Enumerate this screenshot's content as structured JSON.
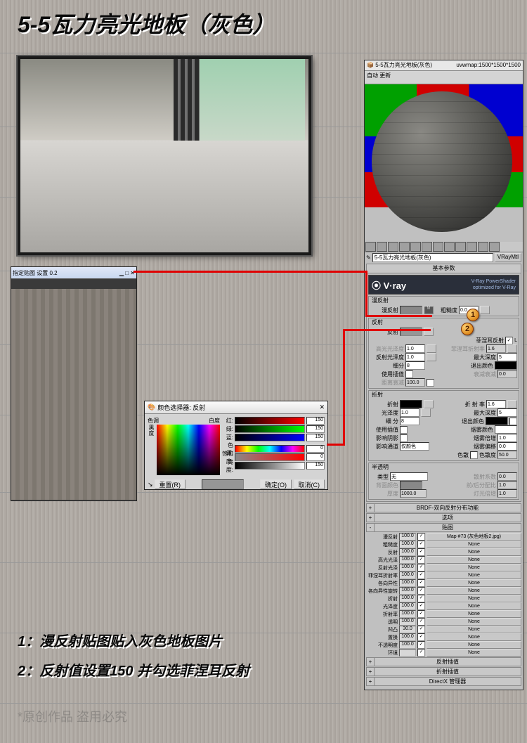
{
  "title": "5-5瓦力亮光地板（灰色）",
  "instruction1": "1：漫反射贴图贴入灰色地板图片",
  "instruction2": "2：反射值设置150 并勾选菲涅耳反射",
  "watermark": "*原创作品 盗用必究",
  "mat_editor": {
    "window_title": "5-5瓦力亮光地板(灰色)",
    "uvw": "uvwmap:1500*1500*1500",
    "toolbar": "自动  更新",
    "material_name": "5-5瓦力亮光地板(灰色)",
    "material_type": "VRayMtl",
    "section_basic": "基本参数",
    "vray_brand": "V·ray",
    "vray_sub": "V-Ray PowerShader",
    "vray_sub2": "optimized for V-Ray",
    "diffuse_grp": "漫反射",
    "diffuse_lbl": "漫反射",
    "roughness_lbl": "粗糙度",
    "roughness_val": "0.0",
    "reflect_grp": "反射",
    "reflect_lbl": "反射",
    "fresnel_lbl": "菲涅耳反射",
    "hilight_lbl": "高光光泽度",
    "hilight_val": "1.0",
    "fresnel_ior_lbl": "菲涅耳折射率",
    "fresnel_ior_val": "1.6",
    "refl_glossy_lbl": "反射光泽度",
    "refl_glossy_val": "1.0",
    "max_depth_lbl": "最大深度",
    "max_depth_val": "5",
    "subdiv_lbl": "细分",
    "subdiv_val": "8",
    "exit_color_lbl": "退出颜色",
    "use_interp_lbl": "使用插值",
    "dim_dist_lbl": "距离衰减",
    "dim_dist_val": "100.0",
    "dim_falloff_lbl": "衰减衰减",
    "dim_falloff_val": "0.0",
    "refract_grp": "折射",
    "refract_lbl": "折射",
    "ior_lbl": "折 射 率",
    "ior_val": "1.6",
    "glossy_lbl": "光泽度",
    "glossy_val": "1.0",
    "refr_depth_lbl": "最大深度",
    "refr_depth_val": "5",
    "refr_sub_lbl": "细 分",
    "refr_sub_val": "8",
    "refr_exit_lbl": "退出颜色",
    "refr_interp_lbl": "使用插值",
    "fog_color_lbl": "烟雾颜色",
    "affect_sh_lbl": "影响阴影",
    "fog_mult_lbl": "烟雾倍增",
    "fog_mult_val": "1.0",
    "affect_ch_lbl": "影响通道",
    "affect_ch_val": "仅颜色",
    "fog_bias_lbl": "烟雾偏移",
    "fog_bias_val": "0.0",
    "dispersion_lbl": "色散",
    "disp_abbe_lbl": "色散度",
    "disp_abbe_val": "50.0",
    "translucent_grp": "半透明",
    "trans_type_lbl": "类型",
    "trans_type_val": "无",
    "scatter_lbl": "散射系数",
    "scatter_val": "0.0",
    "back_color_lbl": "背面颜色",
    "fwd_back_lbl": "前/后分配比",
    "fwd_back_val": "1.0",
    "thickness_lbl": "厚度",
    "thickness_val": "1000.0",
    "light_mult_lbl": "灯光倍增",
    "light_mult_val": "1.0",
    "brdf_rollout": "BRDF-双向反射分布功能",
    "options_rollout": "选项",
    "maps_rollout": "贴图",
    "maps": [
      {
        "lbl": "漫反射",
        "val": "100.0",
        "chk": "✓",
        "slot": "Map #73 (灰色地板2.jpg)"
      },
      {
        "lbl": "粗糙度",
        "val": "100.0",
        "chk": "✓",
        "slot": "None"
      },
      {
        "lbl": "反射",
        "val": "100.0",
        "chk": "✓",
        "slot": "None"
      },
      {
        "lbl": "高光光泽",
        "val": "100.0",
        "chk": "✓",
        "slot": "None"
      },
      {
        "lbl": "反射光泽",
        "val": "100.0",
        "chk": "✓",
        "slot": "None"
      },
      {
        "lbl": "菲涅耳折射率",
        "val": "100.0",
        "chk": "✓",
        "slot": "None"
      },
      {
        "lbl": "各向异性",
        "val": "100.0",
        "chk": "✓",
        "slot": "None"
      },
      {
        "lbl": "各向异性旋转",
        "val": "100.0",
        "chk": "✓",
        "slot": "None"
      },
      {
        "lbl": "折射",
        "val": "100.0",
        "chk": "✓",
        "slot": "None"
      },
      {
        "lbl": "光泽度",
        "val": "100.0",
        "chk": "✓",
        "slot": "None"
      },
      {
        "lbl": "折射率",
        "val": "100.0",
        "chk": "✓",
        "slot": "None"
      },
      {
        "lbl": "透明",
        "val": "100.0",
        "chk": "✓",
        "slot": "None"
      },
      {
        "lbl": "凹凸",
        "val": "30.0",
        "chk": "✓",
        "slot": "None"
      },
      {
        "lbl": "置换",
        "val": "100.0",
        "chk": "✓",
        "slot": "None"
      },
      {
        "lbl": "不透明度",
        "val": "100.0",
        "chk": "✓",
        "slot": "None"
      },
      {
        "lbl": "环境",
        "val": "",
        "chk": "✓",
        "slot": "None"
      }
    ],
    "refl_interp_rollout": "反射插值",
    "refr_interp_rollout": "折射插值",
    "directx_rollout": "DirectX 管理器"
  },
  "color_picker": {
    "title": "颜色选择器: 反射",
    "hue_lbl": "色调",
    "white_lbl": "白度",
    "black_lbl": "黑度",
    "r_lbl": "红:",
    "g_lbl": "绿:",
    "b_lbl": "蓝:",
    "h_lbl": "色调:",
    "s_lbl": "饱和度:",
    "v_lbl": "亮度:",
    "r_val": "150",
    "g_val": "150",
    "b_val": "150",
    "h_val": "0",
    "s_val": "0",
    "v_val": "150",
    "reset": "重置(R)",
    "ok": "确定(O)",
    "cancel": "取消(C)"
  },
  "callout1": "1",
  "callout2": "2"
}
